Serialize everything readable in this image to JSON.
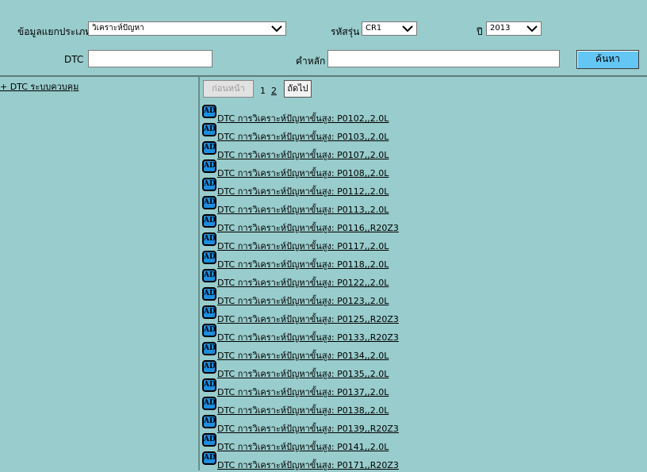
{
  "filters": {
    "category_label": "ข้อมูลแยกประเภท",
    "category_value": "วิเคราะห์ปัญหา",
    "model_label": "รหัสรุ่น",
    "model_value": "CR1",
    "year_label": "ปี",
    "year_value": "2013",
    "dtc_label": "DTC",
    "dtc_value": "",
    "keyword_label": "คำหลัก",
    "keyword_value": "",
    "search_label": "ค้นหา"
  },
  "tree": {
    "root_label": "+ DTC ระบบควบคุม"
  },
  "pagination": {
    "prev_label": "ก่อนหน้า",
    "page1": "1",
    "page2": "2",
    "next_label": "ถัดไป"
  },
  "results": {
    "badge": "AD",
    "items": [
      "DTC การวิเคราะห์ปัญหาขั้นสูง: P0102,,2.0L",
      "DTC การวิเคราะห์ปัญหาขั้นสูง: P0103,,2.0L",
      "DTC การวิเคราะห์ปัญหาขั้นสูง: P0107,,2.0L",
      "DTC การวิเคราะห์ปัญหาขั้นสูง: P0108,,2.0L",
      "DTC การวิเคราะห์ปัญหาขั้นสูง: P0112,,2.0L",
      "DTC การวิเคราะห์ปัญหาขั้นสูง: P0113,,2.0L",
      "DTC การวิเคราะห์ปัญหาขั้นสูง: P0116,,R20Z3",
      "DTC การวิเคราะห์ปัญหาขั้นสูง: P0117,,2.0L",
      "DTC การวิเคราะห์ปัญหาขั้นสูง: P0118,,2.0L",
      "DTC การวิเคราะห์ปัญหาขั้นสูง: P0122,,2.0L",
      "DTC การวิเคราะห์ปัญหาขั้นสูง: P0123,,2.0L",
      "DTC การวิเคราะห์ปัญหาขั้นสูง: P0125,,R20Z3",
      "DTC การวิเคราะห์ปัญหาขั้นสูง: P0133,,R20Z3",
      "DTC การวิเคราะห์ปัญหาขั้นสูง: P0134,,2.0L",
      "DTC การวิเคราะห์ปัญหาขั้นสูง: P0135,,2.0L",
      "DTC การวิเคราะห์ปัญหาขั้นสูง: P0137,,2.0L",
      "DTC การวิเคราะห์ปัญหาขั้นสูง: P0138,,2.0L",
      "DTC การวิเคราะห์ปัญหาขั้นสูง: P0139,,R20Z3",
      "DTC การวิเคราะห์ปัญหาขั้นสูง: P0141,,2.0L",
      "DTC การวิเคราะห์ปัญหาขั้นสูง: P0171,,R20Z3"
    ]
  }
}
